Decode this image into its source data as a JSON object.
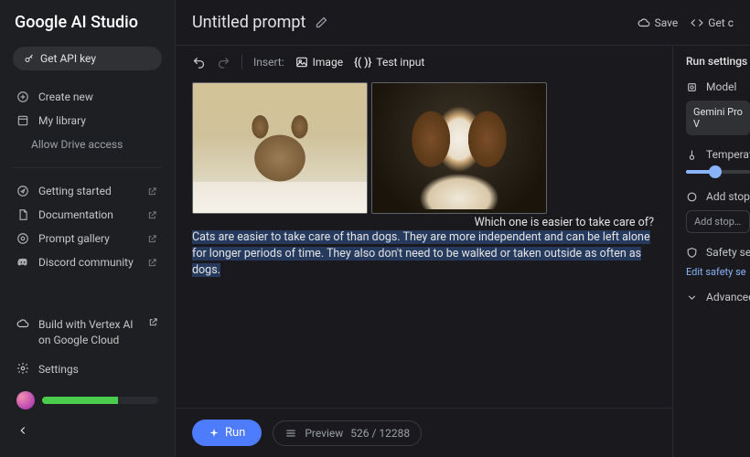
{
  "app": {
    "name": "Google AI Studio"
  },
  "sidebar": {
    "api_chip": "Get API key",
    "items": [
      {
        "label": "Create new"
      },
      {
        "label": "My library"
      },
      {
        "label": "Allow Drive access",
        "sub": true
      },
      {
        "label": "Getting started",
        "ext": true
      },
      {
        "label": "Documentation",
        "ext": true
      },
      {
        "label": "Prompt gallery",
        "ext": true
      },
      {
        "label": "Discord community",
        "ext": true
      }
    ],
    "bottom": {
      "vertex": "Build with Vertex AI on Google Cloud",
      "settings": "Settings"
    }
  },
  "header": {
    "title": "Untitled prompt",
    "save": "Save",
    "getcode": "Get c"
  },
  "toolbar": {
    "insert_label": "Insert:",
    "image": "Image",
    "test_input": "Test input",
    "test_glyph": "{( )}"
  },
  "content": {
    "prompt": "Which one is easier to take care of?",
    "response": "Cats are easier to take care of than dogs. They are more independent and can be left alone for longer periods of time. They also don't need to be walked or taken outside as often as dogs."
  },
  "runbar": {
    "run": "Run",
    "preview": "Preview",
    "tokens": "526 / 12288"
  },
  "settings": {
    "title": "Run settings",
    "model_label": "Model",
    "model_value": "Gemini Pro V",
    "temperature_label": "Temperature",
    "stopseq_label": "Add stop seq",
    "stopseq_placeholder": "Add stop…",
    "safety_label": "Safety setting",
    "safety_link": "Edit safety se",
    "advanced_label": "Advanced set"
  }
}
